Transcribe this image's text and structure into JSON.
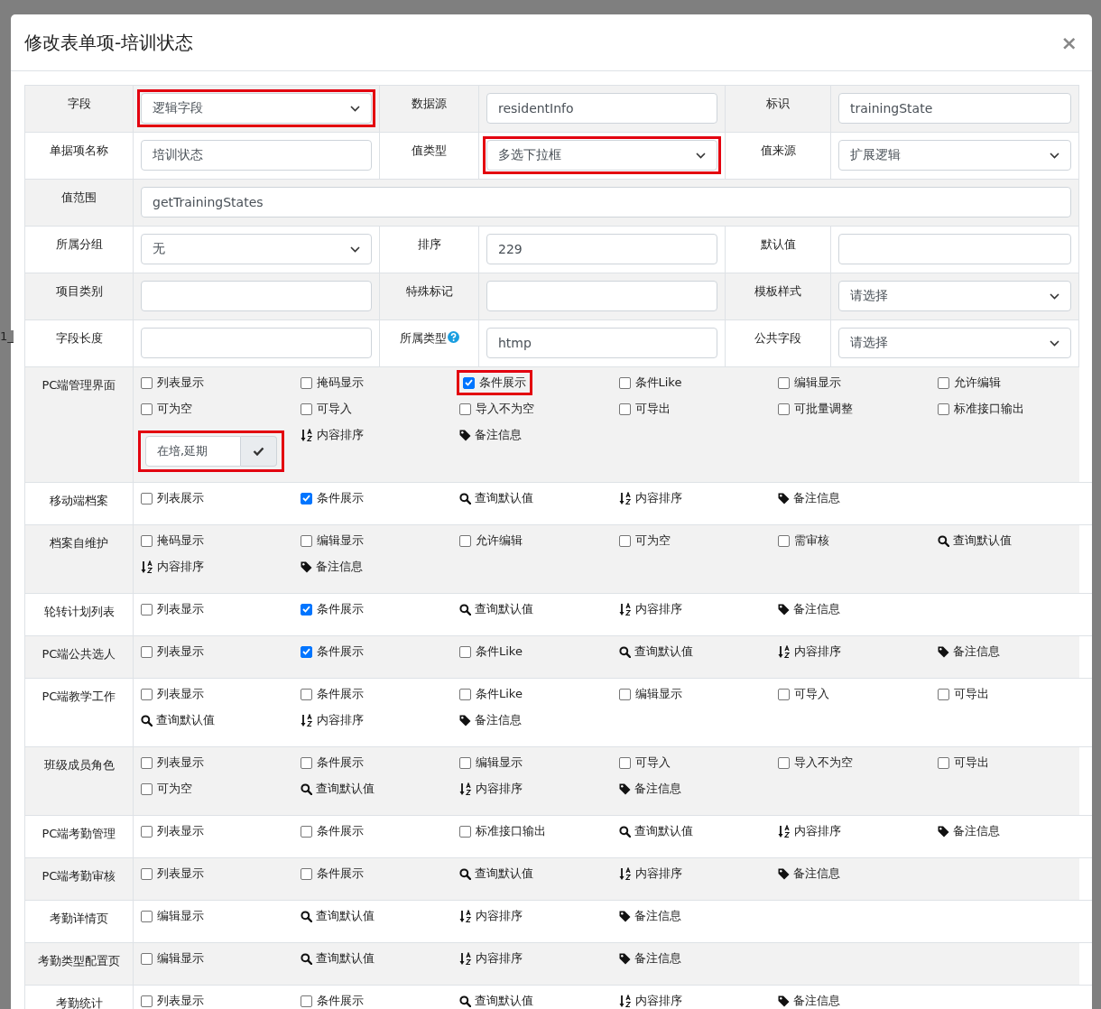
{
  "backdrop_text": "1_",
  "dialog": {
    "title": "修改表单项-培训状态",
    "close": "×"
  },
  "form_rows": [
    {
      "cells": [
        {
          "label": "字段",
          "field": {
            "kind": "select",
            "value": "逻辑字段",
            "highlighted": true
          }
        },
        {
          "label": "数据源",
          "field": {
            "kind": "input",
            "value": "residentInfo",
            "highlighted": false
          }
        },
        {
          "label": "标识",
          "field": {
            "kind": "input",
            "value": "trainingState",
            "highlighted": false
          }
        }
      ]
    },
    {
      "cells": [
        {
          "label": "单据项名称",
          "field": {
            "kind": "input",
            "value": "培训状态",
            "highlighted": false
          }
        },
        {
          "label": "值类型",
          "field": {
            "kind": "select",
            "value": "多选下拉框",
            "highlighted": true
          }
        },
        {
          "label": "值来源",
          "field": {
            "kind": "select",
            "value": "扩展逻辑",
            "highlighted": false
          }
        }
      ]
    },
    {
      "cells": [
        {
          "label": "值范围",
          "field": {
            "kind": "input",
            "value": "getTrainingStates",
            "highlighted": false
          }
        }
      ]
    },
    {
      "cells": [
        {
          "label": "所属分组",
          "field": {
            "kind": "select",
            "value": "无",
            "highlighted": false
          }
        },
        {
          "label": "排序",
          "field": {
            "kind": "input",
            "value": "229",
            "highlighted": false
          }
        },
        {
          "label": "默认值",
          "field": {
            "kind": "input",
            "highlighted": false
          }
        }
      ]
    },
    {
      "cells": [
        {
          "label": "项目类别",
          "field": {
            "kind": "input",
            "highlighted": false
          }
        },
        {
          "label": "特殊标记",
          "field": {
            "kind": "input",
            "highlighted": false
          }
        },
        {
          "label": "模板样式",
          "field": {
            "kind": "select",
            "value": "请选择",
            "highlighted": false
          }
        }
      ]
    },
    {
      "cells": [
        {
          "label": "字段长度",
          "field": {
            "kind": "input",
            "highlighted": false
          }
        },
        {
          "label": "所属类型",
          "help": true,
          "field": {
            "kind": "input",
            "value": "htmp",
            "highlighted": false
          }
        },
        {
          "label": "公共字段",
          "field": {
            "kind": "select",
            "value": "请选择",
            "highlighted": false
          }
        }
      ]
    }
  ],
  "permission_rows": [
    {
      "label": "PC端管理界面",
      "items": [
        {
          "kind": "checkbox",
          "label": "列表显示",
          "checked": false,
          "highlighted": false
        },
        {
          "kind": "checkbox",
          "label": "掩码显示",
          "checked": false,
          "highlighted": false
        },
        {
          "kind": "checkbox",
          "label": "条件展示",
          "checked": true,
          "highlighted": true
        },
        {
          "kind": "checkbox",
          "label": "条件Like",
          "checked": false,
          "highlighted": false
        },
        {
          "kind": "checkbox",
          "label": "编辑显示",
          "checked": false,
          "highlighted": false
        },
        {
          "kind": "checkbox",
          "label": "允许编辑",
          "checked": false,
          "highlighted": false
        },
        {
          "kind": "checkbox",
          "label": "可为空",
          "checked": false,
          "highlighted": false
        },
        {
          "kind": "checkbox",
          "label": "可导入",
          "checked": false,
          "highlighted": false
        },
        {
          "kind": "checkbox",
          "label": "导入不为空",
          "checked": false,
          "highlighted": false
        },
        {
          "kind": "checkbox",
          "label": "可导出",
          "checked": false,
          "highlighted": false
        },
        {
          "kind": "checkbox",
          "label": "可批量调整",
          "checked": false,
          "highlighted": false
        },
        {
          "kind": "checkbox",
          "label": "标准接口输出",
          "checked": false,
          "highlighted": false
        },
        {
          "kind": "inputgroup",
          "value": "在培,延期",
          "highlighted": true
        },
        {
          "kind": "sort",
          "label": "内容排序",
          "highlighted": false
        },
        {
          "kind": "tag",
          "label": "备注信息",
          "highlighted": false
        }
      ]
    },
    {
      "label": "移动端档案",
      "items": [
        {
          "kind": "checkbox",
          "label": "列表展示",
          "checked": false,
          "highlighted": false
        },
        {
          "kind": "checkbox",
          "label": "条件展示",
          "checked": true,
          "highlighted": false
        },
        {
          "kind": "search",
          "label": "查询默认值",
          "highlighted": false
        },
        {
          "kind": "sort",
          "label": "内容排序",
          "highlighted": false
        },
        {
          "kind": "tag",
          "label": "备注信息",
          "highlighted": false
        }
      ]
    },
    {
      "label": "档案自维护",
      "items": [
        {
          "kind": "checkbox",
          "label": "掩码显示",
          "checked": false,
          "highlighted": false
        },
        {
          "kind": "checkbox",
          "label": "编辑显示",
          "checked": false,
          "highlighted": false
        },
        {
          "kind": "checkbox",
          "label": "允许编辑",
          "checked": false,
          "highlighted": false
        },
        {
          "kind": "checkbox",
          "label": "可为空",
          "checked": false,
          "highlighted": false
        },
        {
          "kind": "checkbox",
          "label": "需审核",
          "checked": false,
          "highlighted": false
        },
        {
          "kind": "search",
          "label": "查询默认值",
          "highlighted": false
        },
        {
          "kind": "sort",
          "label": "内容排序",
          "highlighted": false
        },
        {
          "kind": "tag",
          "label": "备注信息",
          "highlighted": false
        }
      ]
    },
    {
      "label": "轮转计划列表",
      "items": [
        {
          "kind": "checkbox",
          "label": "列表显示",
          "checked": false,
          "highlighted": false
        },
        {
          "kind": "checkbox",
          "label": "条件展示",
          "checked": true,
          "highlighted": false
        },
        {
          "kind": "search",
          "label": "查询默认值",
          "highlighted": false
        },
        {
          "kind": "sort",
          "label": "内容排序",
          "highlighted": false
        },
        {
          "kind": "tag",
          "label": "备注信息",
          "highlighted": false
        }
      ]
    },
    {
      "label": "PC端公共选人",
      "items": [
        {
          "kind": "checkbox",
          "label": "列表显示",
          "checked": false,
          "highlighted": false
        },
        {
          "kind": "checkbox",
          "label": "条件展示",
          "checked": true,
          "highlighted": false
        },
        {
          "kind": "checkbox",
          "label": "条件Like",
          "checked": false,
          "highlighted": false
        },
        {
          "kind": "search",
          "label": "查询默认值",
          "highlighted": false
        },
        {
          "kind": "sort",
          "label": "内容排序",
          "highlighted": false
        },
        {
          "kind": "tag",
          "label": "备注信息",
          "highlighted": false
        }
      ]
    },
    {
      "label": "PC端教学工作",
      "items": [
        {
          "kind": "checkbox",
          "label": "列表显示",
          "checked": false,
          "highlighted": false
        },
        {
          "kind": "checkbox",
          "label": "条件展示",
          "checked": false,
          "highlighted": false
        },
        {
          "kind": "checkbox",
          "label": "条件Like",
          "checked": false,
          "highlighted": false
        },
        {
          "kind": "checkbox",
          "label": "编辑显示",
          "checked": false,
          "highlighted": false
        },
        {
          "kind": "checkbox",
          "label": "可导入",
          "checked": false,
          "highlighted": false
        },
        {
          "kind": "checkbox",
          "label": "可导出",
          "checked": false,
          "highlighted": false
        },
        {
          "kind": "search",
          "label": "查询默认值",
          "highlighted": false
        },
        {
          "kind": "sort",
          "label": "内容排序",
          "highlighted": false
        },
        {
          "kind": "tag",
          "label": "备注信息",
          "highlighted": false
        }
      ]
    },
    {
      "label": "班级成员角色",
      "items": [
        {
          "kind": "checkbox",
          "label": "列表显示",
          "checked": false,
          "highlighted": false
        },
        {
          "kind": "checkbox",
          "label": "条件展示",
          "checked": false,
          "highlighted": false
        },
        {
          "kind": "checkbox",
          "label": "编辑显示",
          "checked": false,
          "highlighted": false
        },
        {
          "kind": "checkbox",
          "label": "可导入",
          "checked": false,
          "highlighted": false
        },
        {
          "kind": "checkbox",
          "label": "导入不为空",
          "checked": false,
          "highlighted": false
        },
        {
          "kind": "checkbox",
          "label": "可导出",
          "checked": false,
          "highlighted": false
        },
        {
          "kind": "checkbox",
          "label": "可为空",
          "checked": false,
          "highlighted": false
        },
        {
          "kind": "search",
          "label": "查询默认值",
          "highlighted": false
        },
        {
          "kind": "sort",
          "label": "内容排序",
          "highlighted": false
        },
        {
          "kind": "tag",
          "label": "备注信息",
          "highlighted": false
        }
      ]
    },
    {
      "label": "PC端考勤管理",
      "items": [
        {
          "kind": "checkbox",
          "label": "列表显示",
          "checked": false,
          "highlighted": false
        },
        {
          "kind": "checkbox",
          "label": "条件展示",
          "checked": false,
          "highlighted": false
        },
        {
          "kind": "checkbox",
          "label": "标准接口输出",
          "checked": false,
          "highlighted": false
        },
        {
          "kind": "search",
          "label": "查询默认值",
          "highlighted": false
        },
        {
          "kind": "sort",
          "label": "内容排序",
          "highlighted": false
        },
        {
          "kind": "tag",
          "label": "备注信息",
          "highlighted": false
        }
      ]
    },
    {
      "label": "PC端考勤审核",
      "items": [
        {
          "kind": "checkbox",
          "label": "列表显示",
          "checked": false,
          "highlighted": false
        },
        {
          "kind": "checkbox",
          "label": "条件展示",
          "checked": false,
          "highlighted": false
        },
        {
          "kind": "search",
          "label": "查询默认值",
          "highlighted": false
        },
        {
          "kind": "sort",
          "label": "内容排序",
          "highlighted": false
        },
        {
          "kind": "tag",
          "label": "备注信息",
          "highlighted": false
        }
      ]
    },
    {
      "label": "考勤详情页",
      "items": [
        {
          "kind": "checkbox",
          "label": "编辑显示",
          "checked": false,
          "highlighted": false
        },
        {
          "kind": "search",
          "label": "查询默认值",
          "highlighted": false
        },
        {
          "kind": "sort",
          "label": "内容排序",
          "highlighted": false
        },
        {
          "kind": "tag",
          "label": "备注信息",
          "highlighted": false
        }
      ]
    },
    {
      "label": "考勤类型配置页",
      "items": [
        {
          "kind": "checkbox",
          "label": "编辑显示",
          "checked": false,
          "highlighted": false
        },
        {
          "kind": "search",
          "label": "查询默认值",
          "highlighted": false
        },
        {
          "kind": "sort",
          "label": "内容排序",
          "highlighted": false
        },
        {
          "kind": "tag",
          "label": "备注信息",
          "highlighted": false
        }
      ]
    },
    {
      "label": "考勤统计",
      "items": [
        {
          "kind": "checkbox",
          "label": "列表显示",
          "checked": false,
          "highlighted": false
        },
        {
          "kind": "checkbox",
          "label": "条件展示",
          "checked": false,
          "highlighted": false
        },
        {
          "kind": "search",
          "label": "查询默认值",
          "highlighted": false
        },
        {
          "kind": "sort",
          "label": "内容排序",
          "highlighted": false
        },
        {
          "kind": "tag",
          "label": "备注信息",
          "highlighted": false
        }
      ]
    }
  ]
}
